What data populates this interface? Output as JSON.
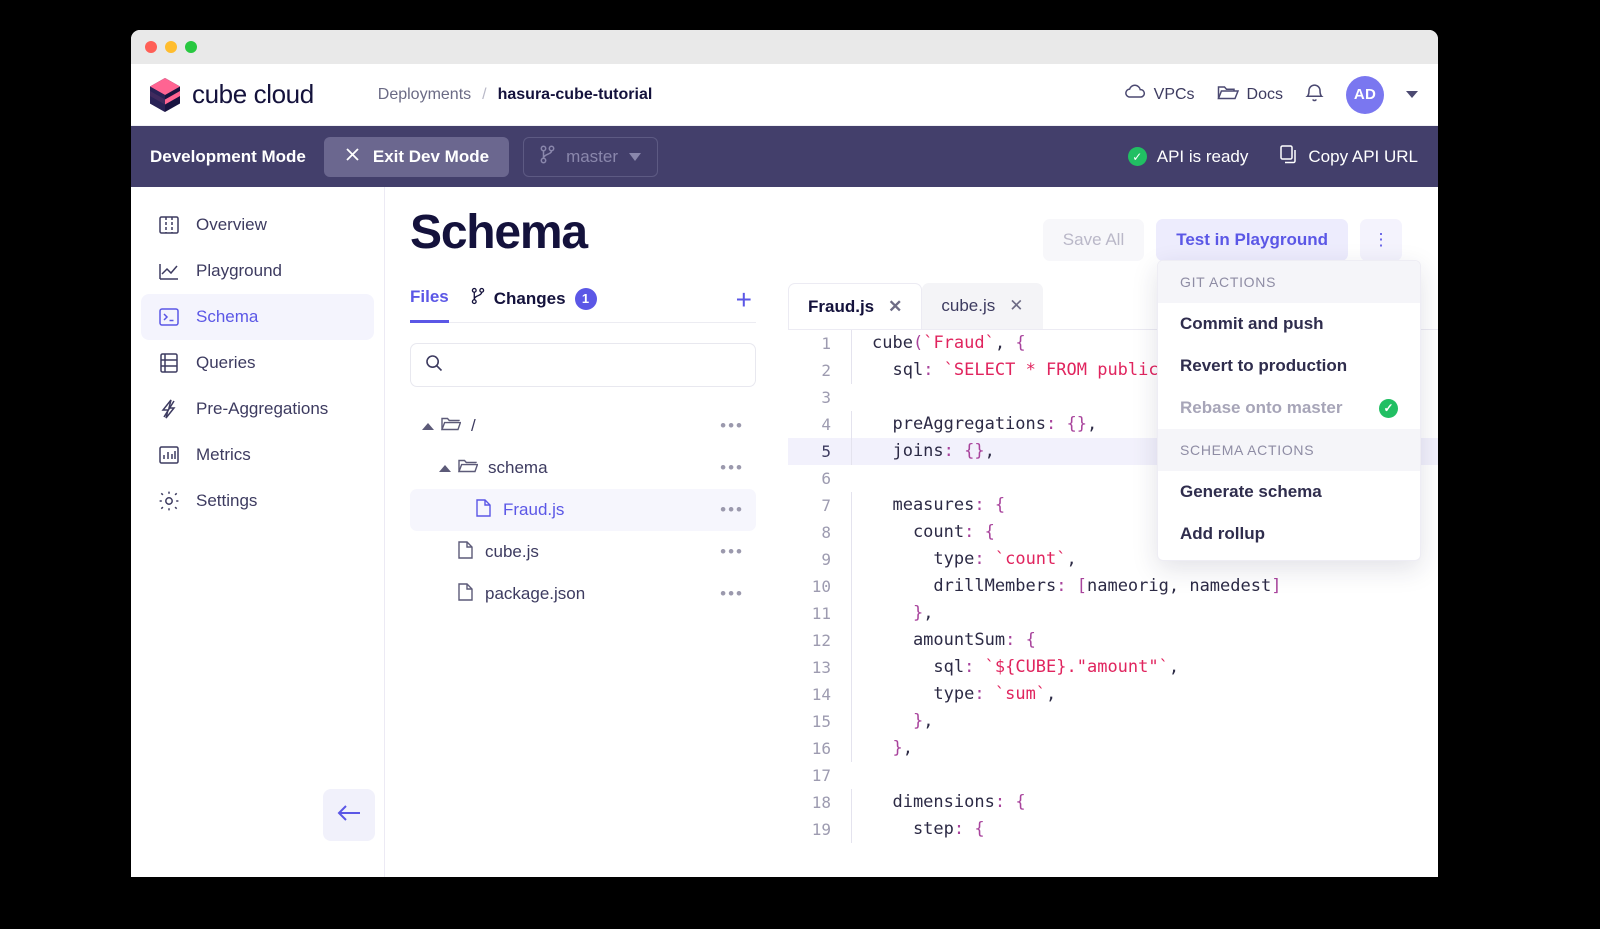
{
  "window": {
    "traffic_lights": [
      "close",
      "minimize",
      "zoom"
    ]
  },
  "header": {
    "logo_text": "cube cloud",
    "breadcrumb": {
      "parent": "Deployments",
      "separator": "/",
      "current": "hasura-cube-tutorial"
    },
    "right_items": [
      {
        "icon": "cloud-icon",
        "label": "VPCs"
      },
      {
        "icon": "folder-icon",
        "label": "Docs"
      }
    ],
    "bell_icon": "bell-icon",
    "avatar_initials": "AD"
  },
  "devbar": {
    "title": "Development Mode",
    "exit_label": "Exit Dev Mode",
    "exit_icon": "close-x-icon",
    "branch": "master",
    "branch_icon": "git-branch-icon",
    "api_status": "API is ready",
    "api_status_icon": "check-circle-icon",
    "copy_url_label": "Copy API URL",
    "copy_icon": "copy-icon",
    "bg": "#433f6b"
  },
  "sidebar": {
    "items": [
      {
        "label": "Overview",
        "icon": "layout-icon",
        "active": false
      },
      {
        "label": "Playground",
        "icon": "chart-line-icon",
        "active": false
      },
      {
        "label": "Schema",
        "icon": "terminal-icon",
        "active": true
      },
      {
        "label": "Queries",
        "icon": "list-icon",
        "active": false
      },
      {
        "label": "Pre-Aggregations",
        "icon": "bolt-icon",
        "active": false
      },
      {
        "label": "Metrics",
        "icon": "bar-chart-icon",
        "active": false
      },
      {
        "label": "Settings",
        "icon": "gear-icon",
        "active": false
      }
    ],
    "collapse_icon": "arrow-left-icon"
  },
  "page": {
    "title": "Schema",
    "buttons": {
      "save_all": "Save All",
      "test_in_playground": "Test in Playground",
      "more": "⋮"
    }
  },
  "files_panel": {
    "tabs": [
      {
        "label": "Files",
        "active": true
      },
      {
        "label": "Changes",
        "active": false,
        "badge": "1",
        "icon": "git-branch-icon"
      }
    ],
    "add_icon": "plus-icon",
    "search": {
      "value": "",
      "placeholder": "",
      "icon": "search-icon"
    },
    "tree": [
      {
        "label": "/",
        "type": "folder",
        "depth": 0,
        "expanded": true,
        "selected": false,
        "menu": "•••"
      },
      {
        "label": "schema",
        "type": "folder",
        "depth": 1,
        "expanded": true,
        "selected": false,
        "menu": "•••"
      },
      {
        "label": "Fraud.js",
        "type": "file",
        "depth": 2,
        "expanded": false,
        "selected": true,
        "menu": "•••"
      },
      {
        "label": "cube.js",
        "type": "file",
        "depth": 1,
        "expanded": false,
        "selected": false,
        "menu": "•••"
      },
      {
        "label": "package.json",
        "type": "file",
        "depth": 1,
        "expanded": false,
        "selected": false,
        "menu": "•••"
      }
    ]
  },
  "editor": {
    "tabs": [
      {
        "label": "Fraud.js",
        "active": true,
        "close": "✕"
      },
      {
        "label": "cube.js",
        "active": false,
        "close": "✕"
      }
    ],
    "highlight_line": 5,
    "lines": [
      {
        "n": "1",
        "text": "cube(`Fraud`, {"
      },
      {
        "n": "2",
        "text": "  sql: `SELECT * FROM public"
      },
      {
        "n": "3",
        "text": ""
      },
      {
        "n": "4",
        "text": "  preAggregations: {},"
      },
      {
        "n": "5",
        "text": "  joins: {},"
      },
      {
        "n": "6",
        "text": ""
      },
      {
        "n": "7",
        "text": "  measures: {"
      },
      {
        "n": "8",
        "text": "    count: {"
      },
      {
        "n": "9",
        "text": "      type: `count`,"
      },
      {
        "n": "10",
        "text": "      drillMembers: [nameorig, namedest]"
      },
      {
        "n": "11",
        "text": "    },"
      },
      {
        "n": "12",
        "text": "    amountSum: {"
      },
      {
        "n": "13",
        "text": "      sql: `${CUBE}.\"amount\"`,"
      },
      {
        "n": "14",
        "text": "      type: `sum`,"
      },
      {
        "n": "15",
        "text": "    },"
      },
      {
        "n": "16",
        "text": "  },"
      },
      {
        "n": "17",
        "text": ""
      },
      {
        "n": "18",
        "text": "  dimensions: {"
      },
      {
        "n": "19",
        "text": "    step: {"
      }
    ]
  },
  "menu": {
    "sections": [
      {
        "header": "GIT ACTIONS",
        "items": [
          {
            "label": "Commit and push",
            "disabled": false,
            "tick": false
          },
          {
            "label": "Revert to production",
            "disabled": false,
            "tick": false
          },
          {
            "label": "Rebase onto master",
            "disabled": true,
            "tick": true
          }
        ]
      },
      {
        "header": "SCHEMA ACTIONS",
        "items": [
          {
            "label": "Generate schema",
            "disabled": false,
            "tick": false
          },
          {
            "label": "Add rollup",
            "disabled": false,
            "tick": false
          }
        ]
      }
    ]
  },
  "colors": {
    "accent": "#5b57e6",
    "dark": "#14123c",
    "devbar": "#433f6b",
    "success": "#21bf63",
    "string": "#e0245e",
    "punct": "#a8439c"
  }
}
